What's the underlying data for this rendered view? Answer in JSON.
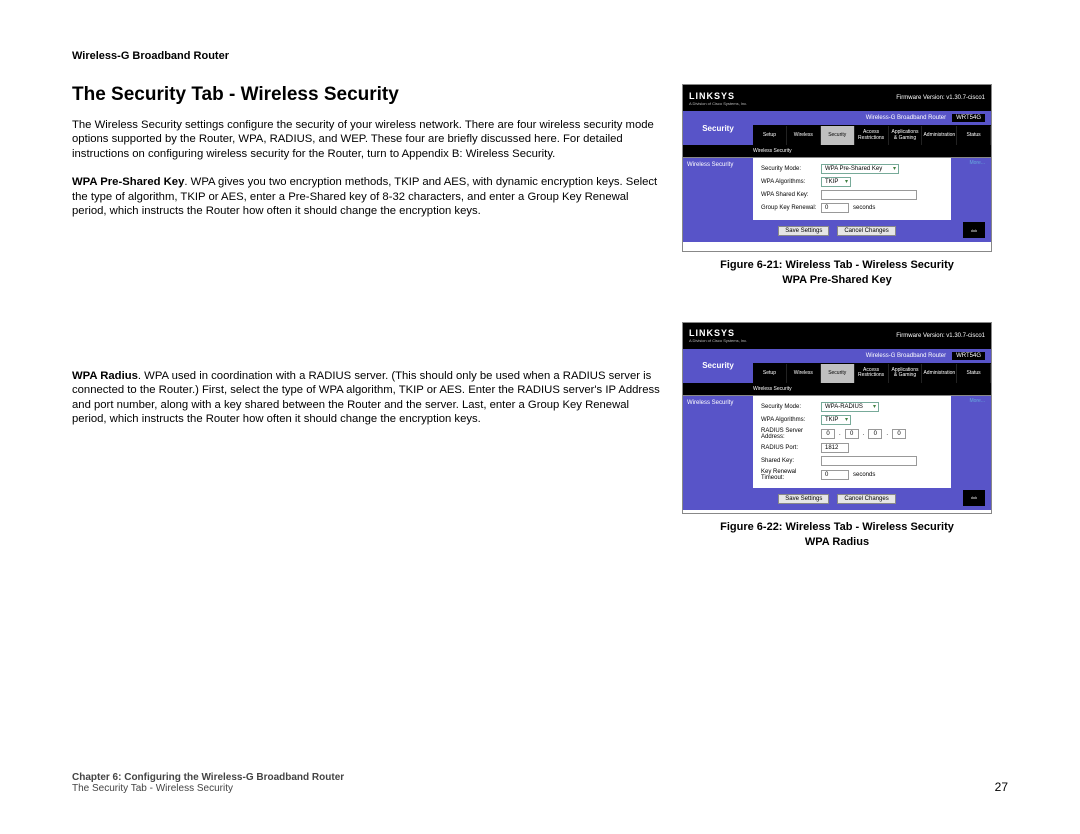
{
  "doc_header": "Wireless-G Broadband Router",
  "section_title": "The Security Tab - Wireless Security",
  "para_intro": "The Wireless Security settings configure the security of your wireless network. There are four wireless security mode options supported by the Router, WPA, RADIUS, and WEP. These four are briefly discussed here. For detailed instructions on configuring wireless security for the Router, turn to Appendix B: Wireless Security.",
  "para_wpa_label": "WPA Pre-Shared Key",
  "para_wpa_body": ". WPA gives you two encryption methods, TKIP and AES, with dynamic encryption keys. Select the type of algorithm, TKIP or AES, enter a Pre-Shared key of 8-32 characters, and enter a Group Key Renewal period, which instructs the Router how often it should change the encryption keys.",
  "para_radius_label": "WPA Radius",
  "para_radius_body": ". WPA used in coordination with a RADIUS server. (This should only be used when a RADIUS server is connected to the Router.) First, select the type of WPA algorithm, TKIP or AES. Enter the RADIUS server's IP Address and port number, along with a key shared between the Router and the server. Last, enter a Group Key Renewal period, which instructs the Router how often it should change the encryption keys.",
  "fig1": {
    "caption_l1": "Figure 6-21: Wireless Tab - Wireless Security",
    "caption_l2": "WPA Pre-Shared Key",
    "brand": "LINKSYS",
    "brand_sub": "A Division of Cisco Systems, Inc.",
    "fw": "Firmware Version: v1.30.7-cisco1",
    "product": "Wireless-G Broadband Router",
    "model": "WRT54G",
    "section": "Security",
    "tabs": [
      "Setup",
      "Wireless",
      "Security",
      "Access Restrictions",
      "Applications & Gaming",
      "Administration",
      "Status"
    ],
    "subtab": "Wireless Security",
    "side_label": "Wireless Security",
    "more": "More...",
    "rows": {
      "mode_lbl": "Security Mode:",
      "mode_val": "WPA Pre-Shared Key",
      "algo_lbl": "WPA Algorithms:",
      "algo_val": "TKIP",
      "key_lbl": "WPA Shared Key:",
      "renew_lbl": "Group Key Renewal:",
      "renew_val": "0",
      "renew_unit": "seconds"
    },
    "btn_save": "Save Settings",
    "btn_cancel": "Cancel Changes",
    "cisco": "CISCO SYSTEMS"
  },
  "fig2": {
    "caption_l1": "Figure 6-22: Wireless Tab - Wireless Security",
    "caption_l2": "WPA Radius",
    "section": "Security",
    "side_label": "Wireless Security",
    "rows": {
      "mode_lbl": "Security Mode:",
      "mode_val": "WPA-RADIUS",
      "algo_lbl": "WPA Algorithms:",
      "algo_val": "TKIP",
      "radius_ip_lbl": "RADIUS Server Address:",
      "ip_a": "0",
      "ip_b": "0",
      "ip_c": "0",
      "ip_d": "0",
      "radius_port_lbl": "RADIUS Port:",
      "radius_port_val": "1812",
      "shared_lbl": "Shared Key:",
      "timeout_lbl": "Key Renewal Timeout:",
      "timeout_val": "0",
      "timeout_unit": "seconds"
    }
  },
  "footer": {
    "chapter": "Chapter 6: Configuring the Wireless-G Broadband Router",
    "sub": "The Security Tab - Wireless Security",
    "page": "27"
  }
}
